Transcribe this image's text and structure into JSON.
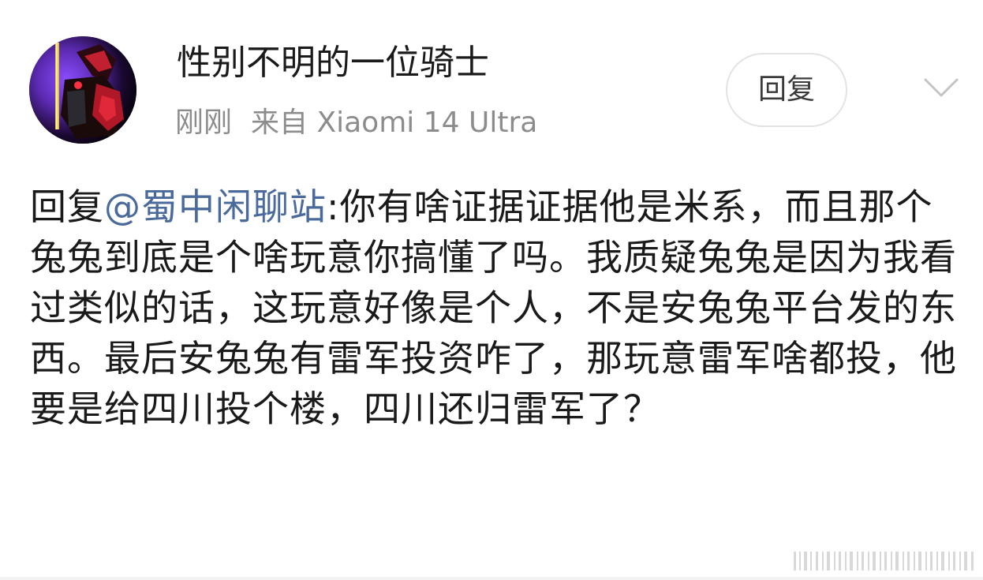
{
  "post": {
    "username": "性别不明的一位骑士",
    "time": "刚刚",
    "source": "来自 Xiaomi 14 Ultra",
    "reply_label": "回复",
    "content": {
      "prefix": "回复",
      "mention": "@蜀中闲聊站",
      "text": ":你有啥证据证据他是米系，而且那个兔兔到底是个啥玩意你搞懂了吗。我质疑兔兔是因为我看过类似的话，这玩意好像是个人，不是安兔兔平台发的东西。最后安兔兔有雷军投资咋了，那玩意雷军啥都投，他要是给四川投个楼，四川还归雷军了？"
    }
  },
  "icons": {
    "avatar": "knight-avatar-image",
    "expand": "chevron-down-icon",
    "watermark": "barcode-watermark"
  },
  "colors": {
    "mention": "#4a6a9c",
    "meta": "#8c8c8c",
    "text": "#1a1a1a"
  }
}
